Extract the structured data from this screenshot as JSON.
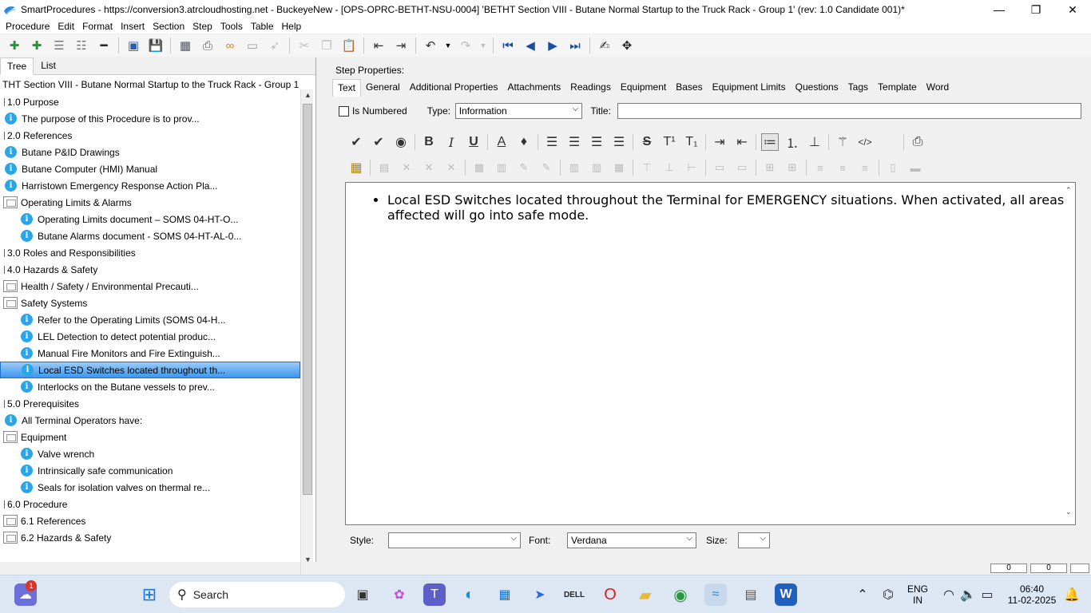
{
  "window": {
    "title": "SmartProcedures - https://conversion3.atrcloudhosting.net - BuckeyeNew - [OPS-OPRC-BETHT-NSU-0004] 'BETHT Section VIII - Butane Normal Startup to the Truck Rack - Group 1' (rev: 1.0 Candidate 001)*",
    "minimize": "—",
    "maximize": "❐",
    "close": "✕"
  },
  "menu": [
    "Procedure",
    "Edit",
    "Format",
    "Insert",
    "Section",
    "Step",
    "Tools",
    "Table",
    "Help"
  ],
  "left_tabs": [
    "Tree",
    "List"
  ],
  "tree": {
    "header": "THT Section VIII - Butane Normal Startup to the Truck Rack - Group 1 (...",
    "rows": [
      {
        "type": "section",
        "indent": 0,
        "label": "1.0 Purpose"
      },
      {
        "type": "info",
        "indent": 0,
        "label": "The purpose of this Procedure is to prov..."
      },
      {
        "type": "section",
        "indent": 0,
        "label": "2.0 References"
      },
      {
        "type": "info",
        "indent": 0,
        "label": "Butane P&ID Drawings"
      },
      {
        "type": "info",
        "indent": 0,
        "label": "Butane Computer (HMI) Manual"
      },
      {
        "type": "info",
        "indent": 0,
        "label": "Harristown Emergency Response Action Pla..."
      },
      {
        "type": "folder",
        "indent": 0,
        "label": "Operating Limits & Alarms"
      },
      {
        "type": "info",
        "indent": 1,
        "label": "Operating Limits document – SOMS 04-HT-O..."
      },
      {
        "type": "info",
        "indent": 1,
        "label": "Butane Alarms document - SOMS 04-HT-AL-0..."
      },
      {
        "type": "section",
        "indent": 0,
        "label": "3.0 Roles and Responsibilities"
      },
      {
        "type": "section",
        "indent": 0,
        "label": "4.0 Hazards & Safety"
      },
      {
        "type": "folder",
        "indent": 0,
        "label": "Health / Safety / Environmental Precauti..."
      },
      {
        "type": "folder",
        "indent": 0,
        "label": "Safety Systems"
      },
      {
        "type": "info",
        "indent": 1,
        "label": "Refer to the Operating Limits (SOMS 04-H..."
      },
      {
        "type": "info",
        "indent": 1,
        "label": "LEL Detection to detect potential produc..."
      },
      {
        "type": "info",
        "indent": 1,
        "label": "Manual Fire Monitors and Fire Extinguish..."
      },
      {
        "type": "info",
        "indent": 1,
        "label": "Local ESD Switches located throughout th...",
        "selected": true
      },
      {
        "type": "info",
        "indent": 1,
        "label": "Interlocks on the Butane vessels to prev..."
      },
      {
        "type": "section",
        "indent": 0,
        "label": "5.0 Prerequisites"
      },
      {
        "type": "info",
        "indent": 0,
        "label": "All Terminal Operators have:"
      },
      {
        "type": "folder",
        "indent": 0,
        "label": "Equipment"
      },
      {
        "type": "info",
        "indent": 1,
        "label": "Valve wrench"
      },
      {
        "type": "info",
        "indent": 1,
        "label": "Intrinsically safe communication"
      },
      {
        "type": "info",
        "indent": 1,
        "label": "Seals for isolation valves on thermal re..."
      },
      {
        "type": "section",
        "indent": 0,
        "label": "6.0 Procedure"
      },
      {
        "type": "folder",
        "indent": 0,
        "label": "6.1 References"
      },
      {
        "type": "folder",
        "indent": 0,
        "label": "6.2 Hazards & Safety"
      }
    ]
  },
  "step_properties": {
    "label": "Step Properties:",
    "tabs": [
      "Text",
      "General",
      "Additional Properties",
      "Attachments",
      "Readings",
      "Equipment",
      "Bases",
      "Equipment Limits",
      "Questions",
      "Tags",
      "Template",
      "Word"
    ],
    "is_numbered_label": "Is Numbered",
    "type_label": "Type:",
    "type_value": "Information",
    "title_label": "Title:",
    "title_value": "",
    "content": "Local ESD Switches located throughout the Terminal for EMERGENCY situations. When activated, all areas affected will go into safe mode.",
    "style_label": "Style:",
    "style_value": "",
    "font_label": "Font:",
    "font_value": "Verdana",
    "size_label": "Size:",
    "size_value": ""
  },
  "status_boxes": [
    "0",
    "0"
  ],
  "taskbar": {
    "search_placeholder": "Search",
    "notification_badge": "1",
    "lang": "ENG",
    "region": "IN",
    "time": "06:40",
    "date": "11-02-2025"
  }
}
